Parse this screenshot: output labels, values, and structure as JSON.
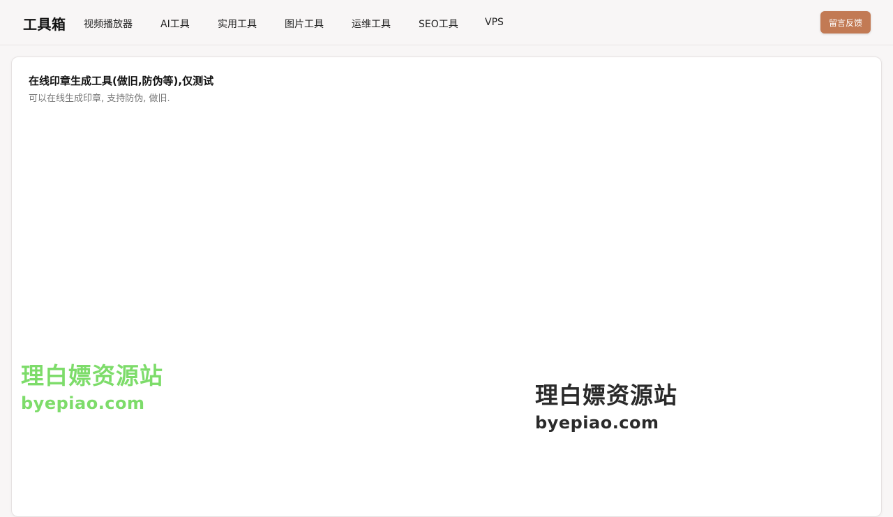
{
  "header": {
    "logo": "工具箱",
    "nav": [
      {
        "label": "视频播放器"
      },
      {
        "label": "AI工具"
      },
      {
        "label": "实用工具"
      },
      {
        "label": "图片工具"
      },
      {
        "label": "运维工具"
      },
      {
        "label": "SEO工具"
      },
      {
        "label": "VPS"
      }
    ],
    "feedback_label": "留言反馈"
  },
  "card": {
    "title": "在线印章生成工具(做旧,防伪等),仅测试",
    "subtitle": "可以在线生成印章, 支持防伪, 做旧."
  },
  "watermarks": [
    {
      "name": "理白嫖资源站",
      "url": "byepiao.com"
    },
    {
      "name": "理白嫖资源站",
      "url": "byepiao.com"
    }
  ],
  "colors": {
    "accent": "#c27a54",
    "watermark_green": "#7ddc6a",
    "watermark_dark": "#2a2a2a"
  }
}
